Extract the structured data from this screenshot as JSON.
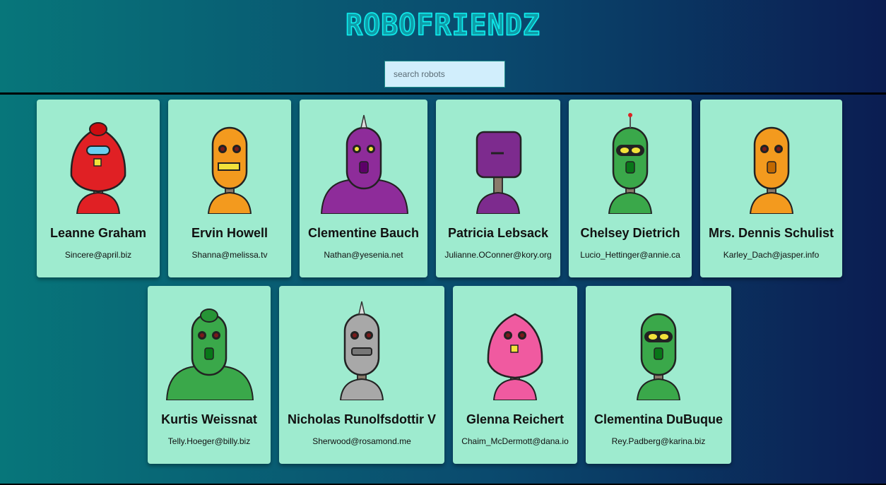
{
  "header": {
    "title": "ROBOFRIENDZ"
  },
  "search": {
    "placeholder": "search robots",
    "value": ""
  },
  "robots": [
    {
      "name": "Leanne Graham",
      "email": "Sincere@april.biz",
      "color": "#e02024"
    },
    {
      "name": "Ervin Howell",
      "email": "Shanna@melissa.tv",
      "color": "#f39a1e"
    },
    {
      "name": "Clementine Bauch",
      "email": "Nathan@yesenia.net",
      "color": "#8e2c9a"
    },
    {
      "name": "Patricia Lebsack",
      "email": "Julianne.OConner@kory.org",
      "color": "#7d2b8e"
    },
    {
      "name": "Chelsey Dietrich",
      "email": "Lucio_Hettinger@annie.ca",
      "color": "#3aa84a"
    },
    {
      "name": "Mrs. Dennis Schulist",
      "email": "Karley_Dach@jasper.info",
      "color": "#f39a1e"
    },
    {
      "name": "Kurtis Weissnat",
      "email": "Telly.Hoeger@billy.biz",
      "color": "#3aa84a"
    },
    {
      "name": "Nicholas Runolfsdottir V",
      "email": "Sherwood@rosamond.me",
      "color": "#a8a8a8"
    },
    {
      "name": "Glenna Reichert",
      "email": "Chaim_McDermott@dana.io",
      "color": "#f05aa0"
    },
    {
      "name": "Clementina DuBuque",
      "email": "Rey.Padberg@karina.biz",
      "color": "#3aa84a"
    }
  ]
}
